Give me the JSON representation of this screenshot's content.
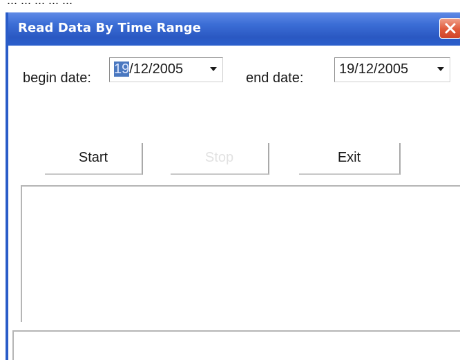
{
  "top_fragment": "... ...  ...  ... ...",
  "window": {
    "title": "Read Data By Time Range"
  },
  "form": {
    "begin_label": "begin date:",
    "begin_value_selected": "19",
    "begin_value_rest": "/12/2005",
    "end_label": "end date:",
    "end_value": "19/12/2005"
  },
  "buttons": {
    "start": "Start",
    "stop": "Stop",
    "exit": "Exit"
  },
  "results_list": [],
  "status_text": "",
  "colors": {
    "titlebar": "#2a58c2",
    "close": "#e05a3a",
    "selection": "#4a78c0"
  },
  "icons": [
    "close-icon",
    "chevron-down-icon"
  ]
}
